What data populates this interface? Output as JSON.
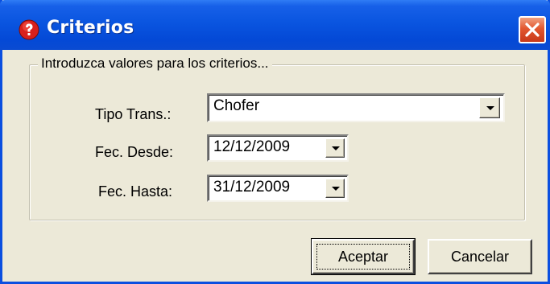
{
  "window": {
    "title": "Criterios",
    "title_icon": "question-mark-icon",
    "close_icon": "close-icon"
  },
  "group": {
    "label": "Introduzca valores para los criterios..."
  },
  "fields": {
    "tipo_trans": {
      "label": "Tipo Trans.:",
      "value": "Chofer"
    },
    "fec_desde": {
      "label": "Fec. Desde:",
      "value": "12/12/2009"
    },
    "fec_hasta": {
      "label": "Fec. Hasta:",
      "value": "31/12/2009"
    }
  },
  "buttons": {
    "accept": "Aceptar",
    "cancel": "Cancelar"
  },
  "colors": {
    "titlebar": "#0a55e0",
    "dialog_bg": "#ece9d8",
    "close_button": "#e2572f",
    "icon_red": "#d9201c"
  }
}
